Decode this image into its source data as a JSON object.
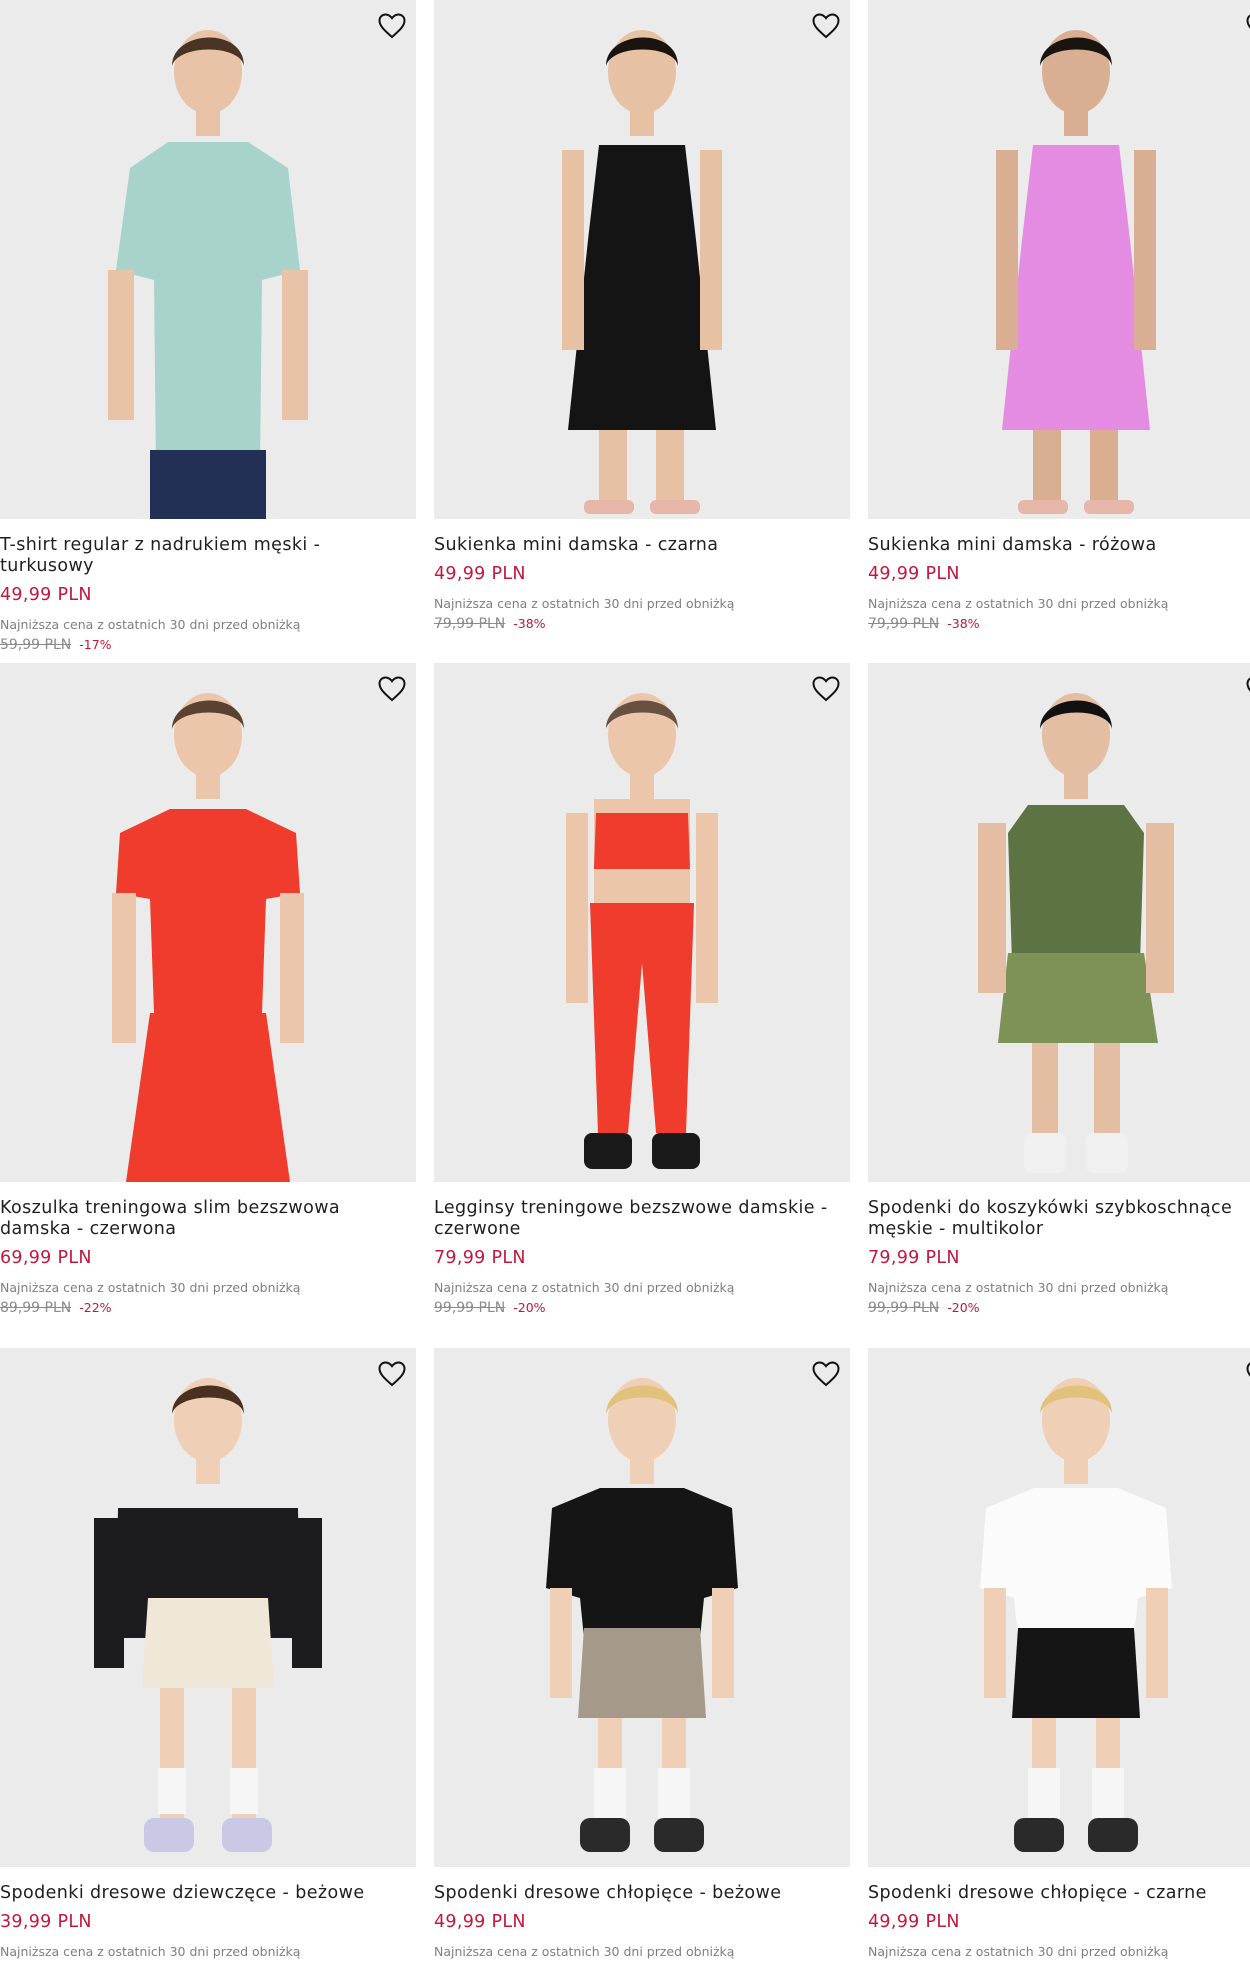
{
  "products": [
    {
      "title": "T-shirt regular z nadrukiem męski - turkusowy",
      "price": "49,99 PLN",
      "lowest": "Najniższa cena z ostatnich 30 dni przed obniżką",
      "old_price": "59,99 PLN",
      "discount": "-17%",
      "image": {
        "top": "#a8d3cb",
        "bottom": "#233056",
        "skin": "#e8c3a8",
        "hair": "#4a3426",
        "kind": "tshirt"
      }
    },
    {
      "title": "Sukienka mini damska - czarna",
      "price": "49,99 PLN",
      "lowest": "Najniższa cena z ostatnich 30 dni przed obniżką",
      "old_price": "79,99 PLN",
      "discount": "-38%",
      "image": {
        "top": "#141414",
        "bottom": "#141414",
        "skin": "#e6c1a4",
        "hair": "#1a1410",
        "kind": "dress"
      }
    },
    {
      "title": "Sukienka mini damska - różowa",
      "price": "49,99 PLN",
      "lowest": "Najniższa cena z ostatnich 30 dni przed obniżką",
      "old_price": "79,99 PLN",
      "discount": "-38%",
      "image": {
        "top": "#e48ce2",
        "bottom": "#e48ce2",
        "skin": "#d9ae92",
        "hair": "#1a1410",
        "kind": "dress"
      }
    },
    {
      "title": "Koszulka treningowa slim bezszwowa damska - czerwona",
      "price": "69,99 PLN",
      "lowest": "Najniższa cena z ostatnich 30 dni przed obniżką",
      "old_price": "89,99 PLN",
      "discount": "-22%",
      "image": {
        "top": "#f03c2c",
        "bottom": "#f03c2c",
        "skin": "#ecc6ab",
        "hair": "#5a4130",
        "kind": "tee-fit"
      }
    },
    {
      "title": "Legginsy treningowe bezszwowe damskie - czerwone",
      "price": "79,99 PLN",
      "lowest": "Najniższa cena z ostatnich 30 dni przed obniżką",
      "old_price": "99,99 PLN",
      "discount": "-20%",
      "image": {
        "top": "#f03c2c",
        "bottom": "#f03c2c",
        "skin": "#ecc6ab",
        "hair": "#6a5040",
        "kind": "leggings"
      }
    },
    {
      "title": "Spodenki do koszykówki szybkoschnące męskie - multikolor",
      "price": "79,99 PLN",
      "lowest": "Najniższa cena z ostatnich 30 dni przed obniżką",
      "old_price": "99,99 PLN",
      "discount": "-20%",
      "image": {
        "top": "#5e7344",
        "bottom": "#7d9256",
        "skin": "#e3bea2",
        "hair": "#111111",
        "kind": "tank"
      }
    },
    {
      "title": "Spodenki dresowe dziewczęce - beżowe",
      "price": "39,99 PLN",
      "lowest": "Najniższa cena z ostatnich 30 dni przed obniżką",
      "old_price": "",
      "discount": "",
      "image": {
        "top": "#1c1c1e",
        "bottom": "#efe8d9",
        "skin": "#efcfb6",
        "hair": "#4a3020",
        "kind": "hoodie"
      }
    },
    {
      "title": "Spodenki dresowe chłopięce - beżowe",
      "price": "49,99 PLN",
      "lowest": "Najniższa cena z ostatnich 30 dni przed obniżką",
      "old_price": "",
      "discount": "",
      "image": {
        "top": "#151515",
        "bottom": "#a59a8a",
        "skin": "#efcfb6",
        "hair": "#e2c27a",
        "kind": "kid-tee"
      }
    },
    {
      "title": "Spodenki dresowe chłopięce - czarne",
      "price": "49,99 PLN",
      "lowest": "Najniższa cena z ostatnich 30 dni przed obniżką",
      "old_price": "",
      "discount": "",
      "image": {
        "top": "#fbfbfb",
        "bottom": "#151515",
        "skin": "#efcfb6",
        "hair": "#e2c27a",
        "kind": "kid-tee"
      }
    }
  ],
  "colors": {
    "price": "#c4173e",
    "image_bg": "#ebebeb",
    "muted": "#7f7f7f"
  },
  "icons": {
    "favorite": "heart-outline-icon"
  }
}
